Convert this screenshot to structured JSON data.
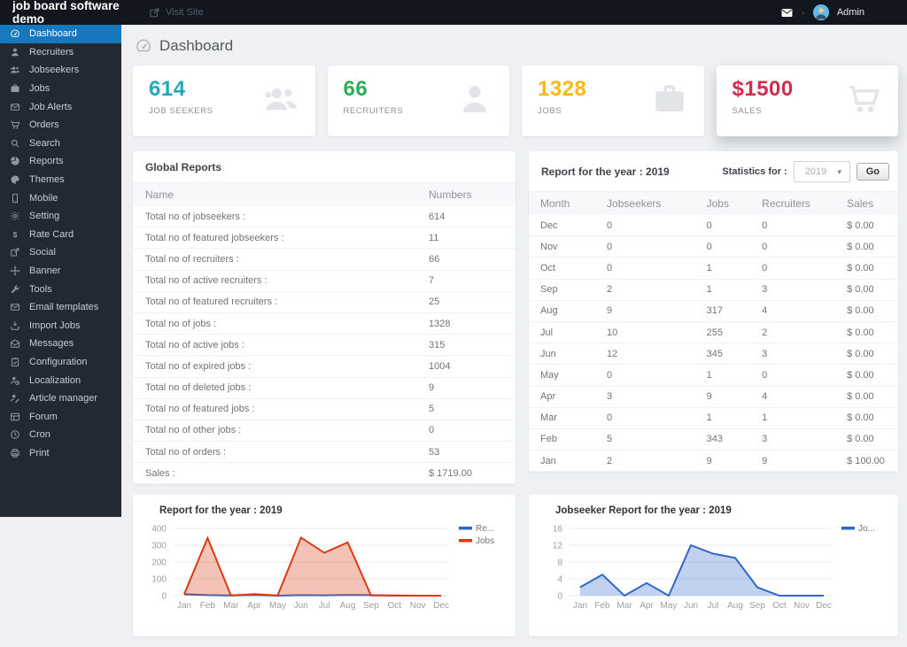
{
  "topbar": {
    "brand": "job board software demo",
    "visit_site": "Visit Site",
    "admin": "Admin"
  },
  "sidebar": {
    "active_color": "#1878be",
    "items": [
      {
        "label": "Dashboard",
        "icon": "dashboard-icon",
        "active": true
      },
      {
        "label": "Recruiters",
        "icon": "user-icon",
        "active": false
      },
      {
        "label": "Jobseekers",
        "icon": "users-icon",
        "active": false
      },
      {
        "label": "Jobs",
        "icon": "briefcase-icon",
        "active": false
      },
      {
        "label": "Job Alerts",
        "icon": "envelope-icon",
        "active": false
      },
      {
        "label": "Orders",
        "icon": "cart-icon",
        "active": false
      },
      {
        "label": "Search",
        "icon": "search-icon",
        "active": false
      },
      {
        "label": "Reports",
        "icon": "pie-chart-icon",
        "active": false
      },
      {
        "label": "Themes",
        "icon": "palette-icon",
        "active": false
      },
      {
        "label": "Mobile",
        "icon": "mobile-icon",
        "active": false
      },
      {
        "label": "Setting",
        "icon": "gear-icon",
        "active": false
      },
      {
        "label": "Rate Card",
        "icon": "dollar-icon",
        "active": false
      },
      {
        "label": "Social",
        "icon": "share-icon",
        "active": false
      },
      {
        "label": "Banner",
        "icon": "move-icon",
        "active": false
      },
      {
        "label": "Tools",
        "icon": "wrench-icon",
        "active": false
      },
      {
        "label": "Email templates",
        "icon": "envelope-icon",
        "active": false
      },
      {
        "label": "Import Jobs",
        "icon": "import-icon",
        "active": false
      },
      {
        "label": "Messages",
        "icon": "open-envelope-icon",
        "active": false
      },
      {
        "label": "Configuration",
        "icon": "clipboard-icon",
        "active": false
      },
      {
        "label": "Localization",
        "icon": "user-globe-icon",
        "active": false
      },
      {
        "label": "Article manager",
        "icon": "user-edit-icon",
        "active": false
      },
      {
        "label": "Forum",
        "icon": "table-icon",
        "active": false
      },
      {
        "label": "Cron",
        "icon": "clock-icon",
        "active": false
      },
      {
        "label": "Print",
        "icon": "printer-icon",
        "active": false
      }
    ]
  },
  "page": {
    "title": "Dashboard"
  },
  "stats": [
    {
      "value": "614",
      "label": "JOB SEEKERS",
      "color": "#22a7bd",
      "icon": "users-icon"
    },
    {
      "value": "66",
      "label": "RECRUITERS",
      "color": "#2eaf55",
      "icon": "user-icon"
    },
    {
      "value": "1328",
      "label": "JOBS",
      "color": "#fdb714",
      "icon": "briefcase-icon"
    },
    {
      "value": "$1500",
      "label": "SALES",
      "color": "#d22d4e",
      "icon": "cart-icon"
    }
  ],
  "global_reports": {
    "title": "Global Reports",
    "columns": [
      "Name",
      "Numbers"
    ],
    "rows": [
      [
        "Total no of jobseekers :",
        "614"
      ],
      [
        "Total no of featured jobseekers :",
        "11"
      ],
      [
        "Total no of recruiters :",
        "66"
      ],
      [
        "Total no of active recruiters :",
        "7"
      ],
      [
        "Total no of featured recruiters :",
        "25"
      ],
      [
        "Total no of jobs :",
        "1328"
      ],
      [
        "Total no of active jobs :",
        "315"
      ],
      [
        "Total no of expired jobs :",
        "1004"
      ],
      [
        "Total no of deleted jobs :",
        "9"
      ],
      [
        "Total no of featured jobs :",
        "5"
      ],
      [
        "Total no of other jobs :",
        "0"
      ],
      [
        "Total no of orders :",
        "53"
      ],
      [
        "Sales :",
        "$ 1719.00"
      ]
    ]
  },
  "year_report": {
    "title": "Report for the year : 2019",
    "stats_label": "Statistics for :",
    "year_value": "2019",
    "go_label": "Go",
    "columns": [
      "Month",
      "Jobseekers",
      "Jobs",
      "Recruiters",
      "Sales"
    ],
    "rows": [
      [
        "Dec",
        "0",
        "0",
        "0",
        "$ 0.00"
      ],
      [
        "Nov",
        "0",
        "0",
        "0",
        "$ 0.00"
      ],
      [
        "Oct",
        "0",
        "1",
        "0",
        "$ 0.00"
      ],
      [
        "Sep",
        "2",
        "1",
        "3",
        "$ 0.00"
      ],
      [
        "Aug",
        "9",
        "317",
        "4",
        "$ 0.00"
      ],
      [
        "Jul",
        "10",
        "255",
        "2",
        "$ 0.00"
      ],
      [
        "Jun",
        "12",
        "345",
        "3",
        "$ 0.00"
      ],
      [
        "May",
        "0",
        "1",
        "0",
        "$ 0.00"
      ],
      [
        "Apr",
        "3",
        "9",
        "4",
        "$ 0.00"
      ],
      [
        "Mar",
        "0",
        "1",
        "1",
        "$ 0.00"
      ],
      [
        "Feb",
        "5",
        "343",
        "3",
        "$ 0.00"
      ],
      [
        "Jan",
        "2",
        "9",
        "9",
        "$ 100.00"
      ]
    ]
  },
  "chart_data": [
    {
      "type": "line",
      "title": "Report for the year : 2019",
      "x": [
        "Jan",
        "Feb",
        "Mar",
        "Apr",
        "May",
        "Jun",
        "Jul",
        "Aug",
        "Sep",
        "Oct",
        "Nov",
        "Dec"
      ],
      "series": [
        {
          "name": "Recruiters",
          "legend": "Re...",
          "color": "#3366cc",
          "values": [
            9,
            3,
            1,
            4,
            0,
            3,
            2,
            4,
            3,
            0,
            0,
            0
          ]
        },
        {
          "name": "Jobs",
          "legend": "Jobs",
          "color": "#dc3912",
          "values": [
            9,
            343,
            1,
            9,
            1,
            345,
            255,
            317,
            1,
            1,
            0,
            0
          ]
        }
      ],
      "ylim": [
        0,
        400
      ],
      "yticks": [
        400,
        300,
        200,
        100,
        0
      ],
      "grid": true,
      "legend_position": "right"
    },
    {
      "type": "line",
      "title": "Jobseeker Report for the year : 2019",
      "x": [
        "Jan",
        "Feb",
        "Mar",
        "Apr",
        "May",
        "Jun",
        "Jul",
        "Aug",
        "Sep",
        "Oct",
        "Nov",
        "Dec"
      ],
      "series": [
        {
          "name": "Jobseekers",
          "legend": "Jo...",
          "color": "#3366cc",
          "values": [
            2,
            5,
            0,
            3,
            0,
            12,
            10,
            9,
            2,
            0,
            0,
            0
          ]
        }
      ],
      "ylim": [
        0,
        16
      ],
      "yticks": [
        16,
        12,
        8,
        4,
        0
      ],
      "grid": true,
      "legend_position": "right"
    }
  ]
}
